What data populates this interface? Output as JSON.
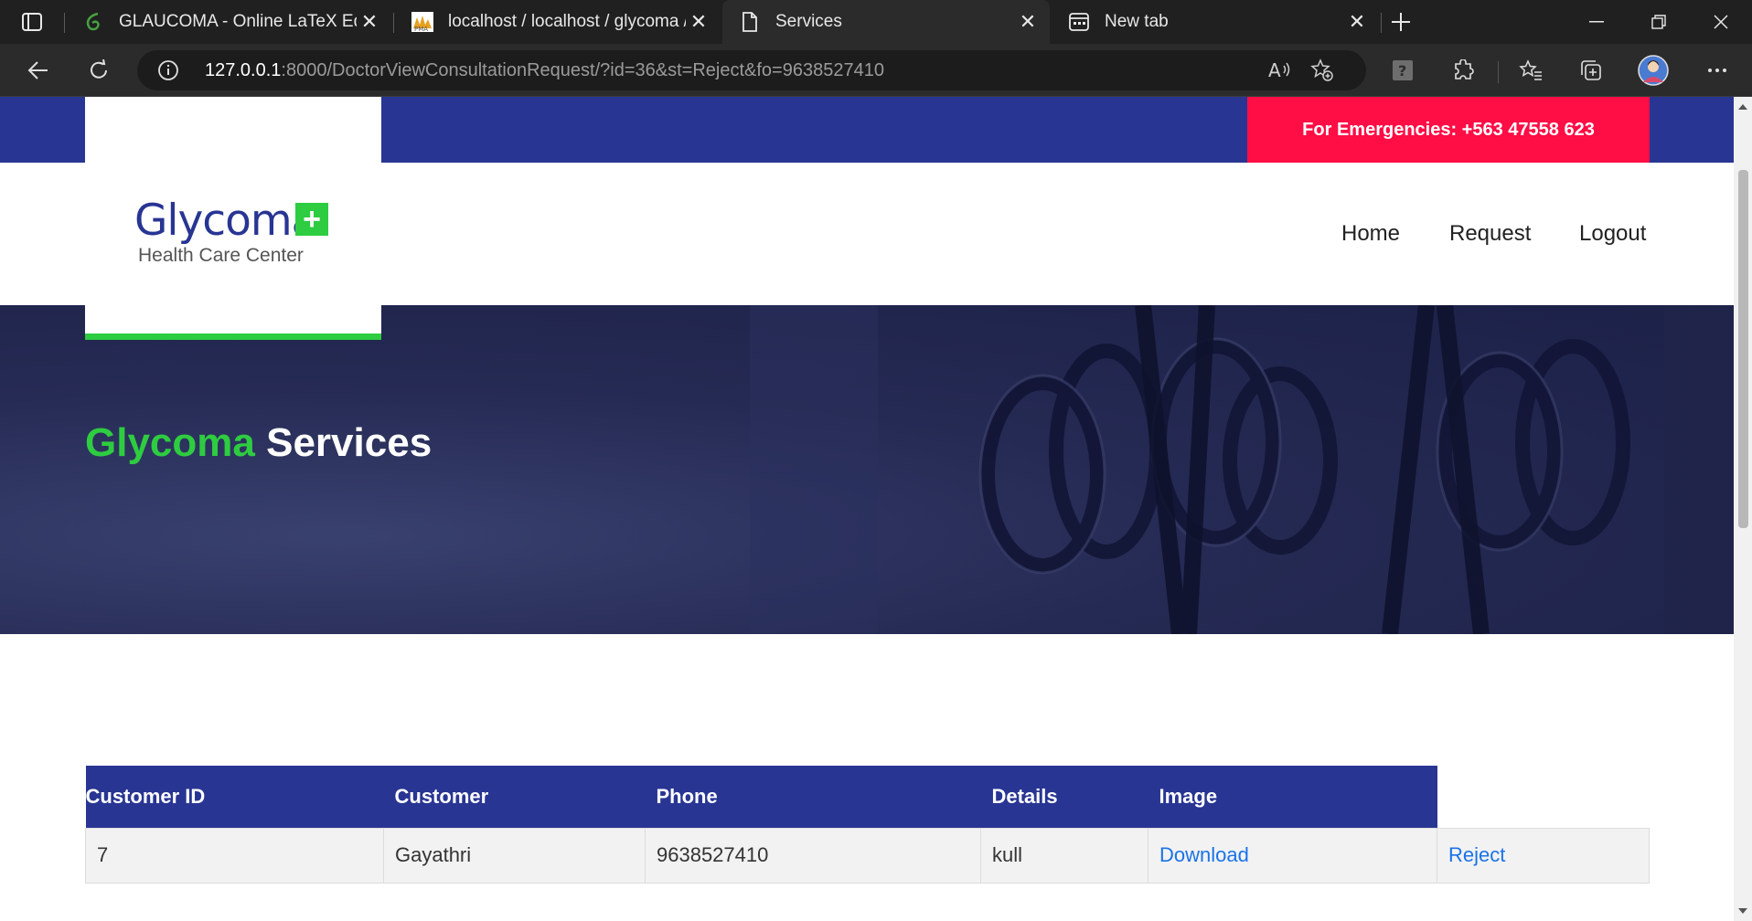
{
  "browser": {
    "tabs": [
      {
        "title": "GLAUCOMA - Online LaTeX Editor",
        "icon": "overleaf-icon"
      },
      {
        "title": "localhost / localhost / glycoma / ",
        "icon": "phpmyadmin-icon"
      },
      {
        "title": "Services",
        "icon": "page-icon"
      },
      {
        "title": "New tab",
        "icon": "newtab-icon"
      }
    ],
    "address": {
      "host": "127.0.0.1",
      "path": ":8000/DoctorViewConsultationRequest/?id=36&st=Reject&fo=9638527410"
    }
  },
  "site": {
    "emergency": "For Emergencies: +563 47558 623",
    "logo": {
      "name": "Glycoma",
      "plus": "+",
      "subtitle": "Health Care Center"
    },
    "nav": [
      "Home",
      "Request",
      "Logout"
    ],
    "hero": {
      "title_green": "Glycoma",
      "title_white": "Services"
    }
  },
  "table": {
    "headers": [
      "Customer ID",
      "Customer",
      "Phone",
      "Details",
      "Image",
      ""
    ],
    "rows": [
      {
        "id": "7",
        "customer": "Gayathri",
        "phone": "9638527410",
        "details": "kull",
        "image_link": "Download",
        "action_link": "Reject"
      }
    ]
  },
  "colors": {
    "brand_blue": "#283593",
    "brand_green": "#2ecc40",
    "emergency_red": "#ff0d45",
    "link_blue": "#1a73e8"
  }
}
